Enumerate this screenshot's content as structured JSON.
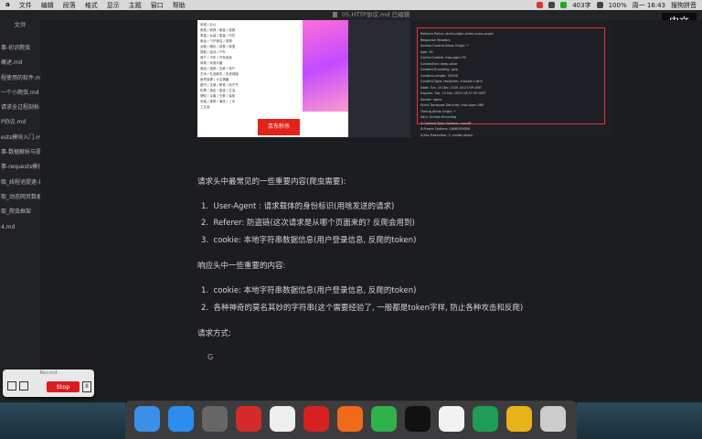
{
  "menubar": {
    "items": [
      "a",
      "文件",
      "编辑",
      "段落",
      "格式",
      "显示",
      "主题",
      "窗口",
      "帮助"
    ],
    "right_text": [
      "403字",
      "100%",
      "周一 16:43",
      "搜狗拼音"
    ]
  },
  "sidebar": {
    "title": "文件",
    "items": [
      "事-初识爬虫",
      "概述.md",
      "程使用的软件.md",
      "一个小爬虫.md",
      "请求全过程剖析.md",
      "P协议.md",
      "ests模块入门.md",
      "事-数据解析与提取",
      "事-requests模块进阶",
      "取_线程池提速-异步爬虫",
      "取_动态网页数据爬取",
      "取_爬虫框架",
      "4.md"
    ]
  },
  "titlebar": {
    "filename": "05.HTTP协议.md",
    "status": "已编辑"
  },
  "ime_badge": "中文",
  "embedded": {
    "list_lines": [
      "电视 / 办公",
      "家居 / 家具 / 家装 / 厨具",
      "男装 / 女装 / 童装 / 内衣",
      "美妆 / 个护清洁 / 宠物",
      "女鞋 / 箱包 / 钟表 / 珠宝",
      "男鞋 / 运动 / 户外",
      "房产 / 汽车 / 汽车用品",
      "母婴 / 玩具乐器",
      "食品 / 酒类 / 生鲜 / 特产",
      "艺术 / 礼品鲜花 / 农资绿植",
      "医药保健 / 计生情趣",
      "图书 / 文娱 / 教育 / 电子书",
      "机票 / 酒店 / 旅游 / 生活",
      "理财 / 众筹 / 白条 / 保险",
      "安装 / 维修 / 清洗 / 二手",
      "工业品"
    ],
    "promo": "京东秒杀",
    "headers_lines": [
      "Referrer-Policy: strict-origin-when-cross-origin",
      "Response Headers",
      "Access-Control-Allow-Origin: *",
      "Age: 19",
      "Cache-Control: max-age=30",
      "Connection: keep-alive",
      "Content-Encoding: gzip",
      "Content-Length: 35298",
      "Content-Type: text/html; charset=utf-8",
      "Date: Tue, 15 Dec 2020 16:27:09 GMT",
      "Expires: Tue, 15 Dec 2020 16:27:39 GMT",
      "Server: nginx",
      "Strict-Transport-Security: max-age=360",
      "Timing-Allow-Origin: *",
      "Vary: Accept-Encoding",
      "X-Content-Type-Options: nosniff",
      "X-Frame-Options: SAMEORIGIN",
      "X-Xss-Protection: 1; mode=block",
      "Request Headers",
      "Accept: text/html,application/xhtml+xml,application/xml;q=0.9"
    ]
  },
  "doc": {
    "intro_request": "请求头中最常见的一些重要内容(爬虫需要):",
    "request_items": [
      "User-Agent : 请求载体的身份标识(用啥发送的请求)",
      "Referer: 防盗链(这次请求是从哪个页面来的?  反爬会用到)",
      "cookie: 本地字符串数据信息(用户登录信息, 反爬的token)"
    ],
    "intro_response": "响应头中一些重要的内容:",
    "response_items": [
      "cookie: 本地字符串数据信息(用户登录信息, 反爬的token)",
      "各种神奇的莫名其妙的字符串(这个需要经验了, 一般都是token字样, 防止各种攻击和反爬)"
    ],
    "intro_methods": "请求方式:",
    "typing": "G"
  },
  "record": {
    "title": "Record",
    "stop_label": "Stop",
    "pause_label": "II"
  },
  "dock": [
    "Finder",
    "Safari",
    "Launchpad",
    "NetEase Music",
    "Chrome",
    "Opera",
    "Firefox",
    "WeChat",
    "QQ",
    "Typora",
    "PyCharm",
    "Xcode",
    "Trash"
  ]
}
